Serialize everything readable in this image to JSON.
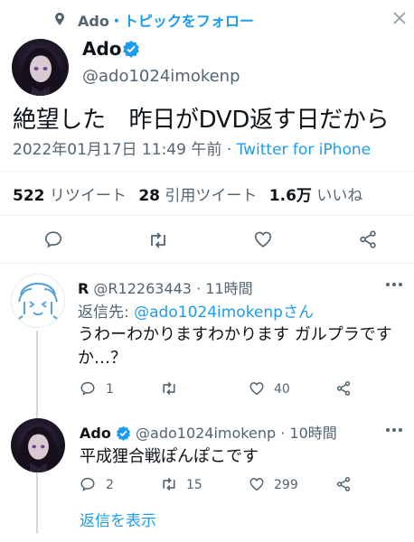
{
  "topic": {
    "prefix": "Ado",
    "link": "・トピックをフォロー"
  },
  "main_tweet": {
    "display_name": "Ado",
    "handle": "@ado1024imokenp",
    "text": "絶望した　昨日がDVD返す日だから",
    "timestamp": "2022年01月17日 11:49 午前 ·",
    "source": "Twitter for iPhone"
  },
  "stats": {
    "retweets_count": "522",
    "retweets_label": "リツイート",
    "quotes_count": "28",
    "quotes_label": "引用ツイート",
    "likes_count": "1.6万",
    "likes_label": "いいね"
  },
  "reply1": {
    "display_name": "R",
    "handle_time": "@R12263443 · 11時間",
    "reply_to_prefix": "返信先:",
    "reply_to_handle": "@ado1024imokenpさん",
    "text_line1": "うわーわかりますわかります ガルプラです",
    "text_line2": "か…？",
    "reply_count": "1",
    "retweet_count": "",
    "like_count": "40"
  },
  "reply2": {
    "display_name": "Ado",
    "handle_time": "@ado1024imokenp · 10時間",
    "text": "平成狸合戦ぽんぽこです",
    "reply_count": "2",
    "retweet_count": "15",
    "like_count": "299"
  },
  "show_replies": "返信を表示",
  "colors": {
    "accent": "#1d9bf0",
    "muted": "#536471",
    "text": "#0f1419",
    "divider": "#eff3f4"
  }
}
